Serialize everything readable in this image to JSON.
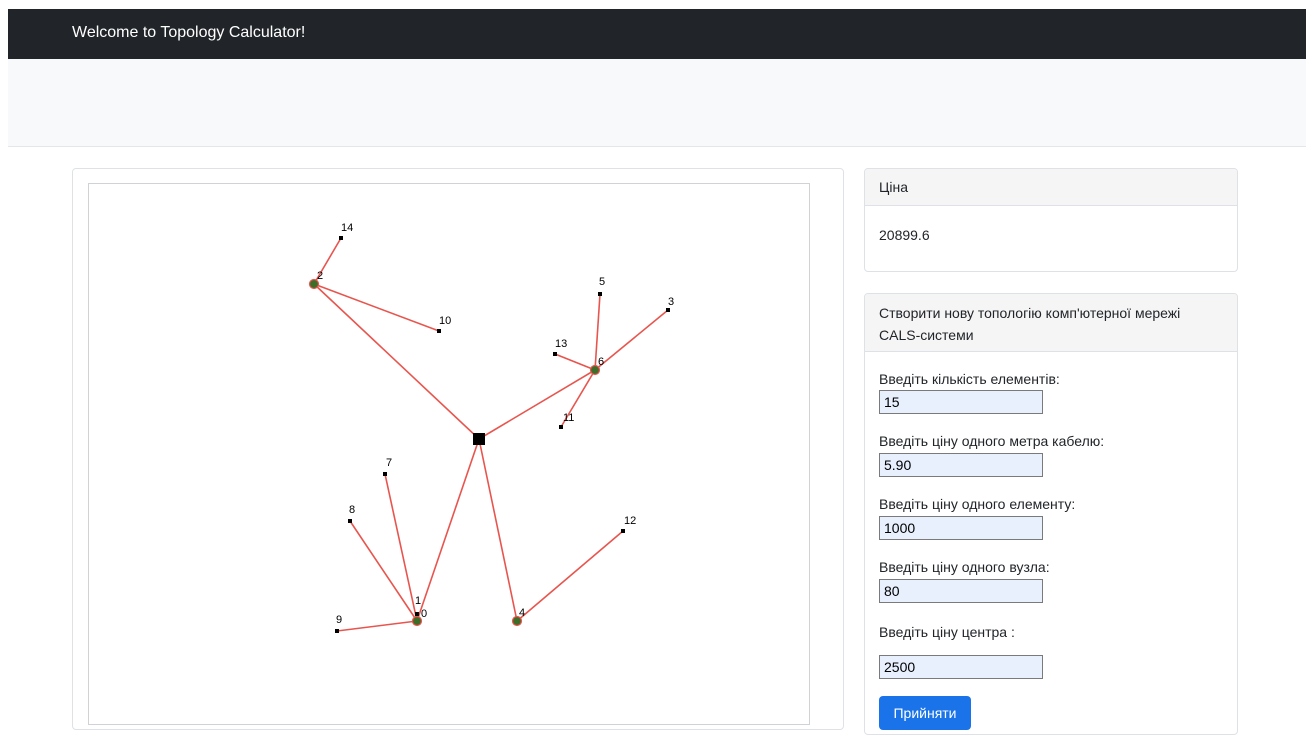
{
  "navbar": {
    "title": "Welcome to Topology Calculator!"
  },
  "price": {
    "header": "Ціна",
    "value": "20899.6"
  },
  "form": {
    "header": "Створити нову топологію комп'ютерної мережі CALS-системи",
    "fields": [
      {
        "label": "Введіть кількість елементів:",
        "value": "15"
      },
      {
        "label": "Введіть ціну одного метра кабелю:",
        "value": "5.90"
      },
      {
        "label": "Введіть ціну одного елементу:",
        "value": "1000"
      },
      {
        "label": "Введіть ціну одного вузла:",
        "value": "80"
      },
      {
        "label": "Введіть ціну центра :",
        "value": "2500"
      }
    ],
    "submit_label": "Прийняти"
  },
  "topology": {
    "nodes": [
      {
        "id": "0",
        "label": "0",
        "kind": "hub"
      },
      {
        "id": "1",
        "label": "1",
        "kind": "element"
      },
      {
        "id": "2",
        "label": "2",
        "kind": "hub"
      },
      {
        "id": "3",
        "label": "3",
        "kind": "element"
      },
      {
        "id": "4",
        "label": "4",
        "kind": "hub"
      },
      {
        "id": "5",
        "label": "5",
        "kind": "element"
      },
      {
        "id": "6",
        "label": "6",
        "kind": "hub"
      },
      {
        "id": "7",
        "label": "7",
        "kind": "element"
      },
      {
        "id": "8",
        "label": "8",
        "kind": "element"
      },
      {
        "id": "9",
        "label": "9",
        "kind": "element"
      },
      {
        "id": "10",
        "label": "10",
        "kind": "element"
      },
      {
        "id": "11",
        "label": "11",
        "kind": "element"
      },
      {
        "id": "12",
        "label": "12",
        "kind": "element"
      },
      {
        "id": "13",
        "label": "13",
        "kind": "element"
      },
      {
        "id": "14",
        "label": "14",
        "kind": "element"
      },
      {
        "id": "center",
        "label": "",
        "kind": "center"
      }
    ],
    "links": [
      [
        "center",
        "2"
      ],
      [
        "center",
        "6"
      ],
      [
        "center",
        "0"
      ],
      [
        "center",
        "4"
      ],
      [
        "2",
        "14"
      ],
      [
        "2",
        "10"
      ],
      [
        "6",
        "5"
      ],
      [
        "6",
        "3"
      ],
      [
        "6",
        "13"
      ],
      [
        "6",
        "11"
      ],
      [
        "0",
        "7"
      ],
      [
        "0",
        "8"
      ],
      [
        "0",
        "9"
      ],
      [
        "0",
        "1"
      ],
      [
        "4",
        "12"
      ]
    ],
    "colors": {
      "link": "#e8554e",
      "hub_fill": "#3c6e2a",
      "hub_stroke": "#e8554e",
      "element": "#000000"
    }
  }
}
